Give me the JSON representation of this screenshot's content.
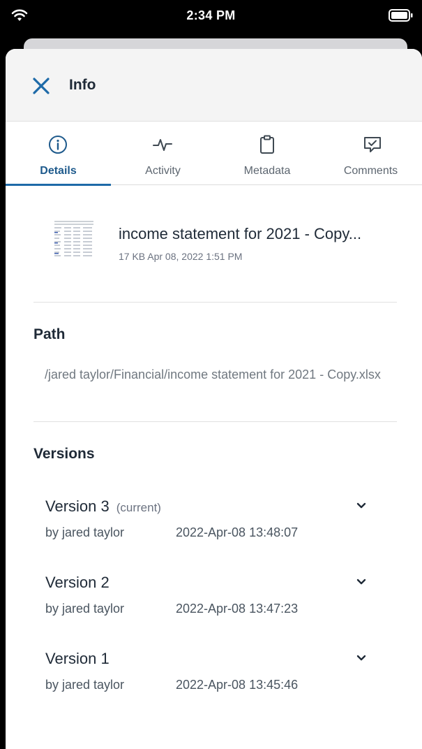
{
  "status_bar": {
    "time": "2:34 PM"
  },
  "header": {
    "title": "Info"
  },
  "tabs": [
    {
      "label": "Details",
      "icon": "info-icon",
      "active": true
    },
    {
      "label": "Activity",
      "icon": "activity-icon",
      "active": false
    },
    {
      "label": "Metadata",
      "icon": "clipboard-icon",
      "active": false
    },
    {
      "label": "Comments",
      "icon": "comment-icon",
      "active": false
    }
  ],
  "file": {
    "name": "income statement for 2021 - Copy...",
    "meta": "17 KB Apr 08, 2022 1:51 PM"
  },
  "path": {
    "title": "Path",
    "value": "/jared taylor/Financial/income statement for 2021 - Copy.xlsx"
  },
  "versions": {
    "title": "Versions",
    "items": [
      {
        "title": "Version 3",
        "tag": "(current)",
        "by": "by jared taylor",
        "date": "2022-Apr-08 13:48:07"
      },
      {
        "title": "Version 2",
        "tag": "",
        "by": "by jared taylor",
        "date": "2022-Apr-08 13:47:23"
      },
      {
        "title": "Version 1",
        "tag": "",
        "by": "by jared taylor",
        "date": "2022-Apr-08 13:45:46"
      }
    ]
  },
  "colors": {
    "accent": "#1e6aa8",
    "text": "#1f2a37",
    "muted": "#707880"
  }
}
